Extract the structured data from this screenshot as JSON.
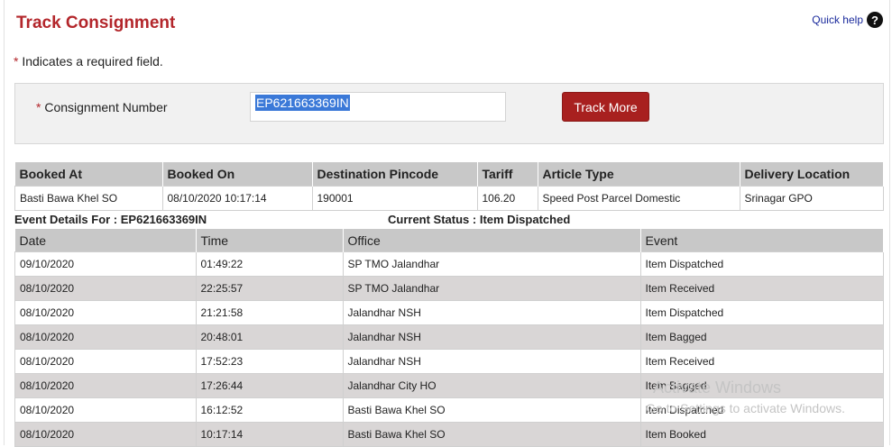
{
  "page": {
    "title": "Track Consignment",
    "quick_help": "Quick help",
    "help_glyph": "?",
    "required_note": {
      "star": "*",
      "text": " Indicates a required field."
    }
  },
  "search": {
    "required_star": "*",
    "label": " Consignment Number",
    "value": "EP621663369IN",
    "button": "Track More"
  },
  "booking": {
    "columns": [
      "Booked At",
      "Booked On",
      "Destination Pincode",
      "Tariff",
      "Article Type",
      "Delivery Location"
    ],
    "row": [
      "Basti Bawa Khel SO",
      "08/10/2020 10:17:14",
      "190001",
      "106.20",
      "Speed Post Parcel Domestic",
      "Srinagar GPO"
    ]
  },
  "event_details": {
    "for_label": "Event Details For : EP621663369IN",
    "status_label": "Current Status : Item Dispatched"
  },
  "events": {
    "columns": [
      "Date",
      "Time",
      "Office",
      "Event"
    ],
    "rows": [
      [
        "09/10/2020",
        "01:49:22",
        "SP TMO Jalandhar",
        "Item Dispatched"
      ],
      [
        "08/10/2020",
        "22:25:57",
        "SP TMO Jalandhar",
        "Item Received"
      ],
      [
        "08/10/2020",
        "21:21:58",
        "Jalandhar NSH",
        "Item Dispatched"
      ],
      [
        "08/10/2020",
        "20:48:01",
        "Jalandhar NSH",
        "Item Bagged"
      ],
      [
        "08/10/2020",
        "17:52:23",
        "Jalandhar NSH",
        "Item Received"
      ],
      [
        "08/10/2020",
        "17:26:44",
        "Jalandhar City HO",
        "Item Bagged"
      ],
      [
        "08/10/2020",
        "16:12:52",
        "Basti Bawa Khel SO",
        "Item Dispatched"
      ],
      [
        "08/10/2020",
        "10:17:14",
        "Basti Bawa Khel SO",
        "Item Booked"
      ]
    ]
  },
  "watermark": {
    "line1": "Activate Windows",
    "line2": "Go to Settings to activate Windows."
  },
  "colors": {
    "accent": "#b3262b",
    "button": "#a8201f",
    "header_bg": "#c8c8c8",
    "alt_row": "#d9d6d6"
  }
}
